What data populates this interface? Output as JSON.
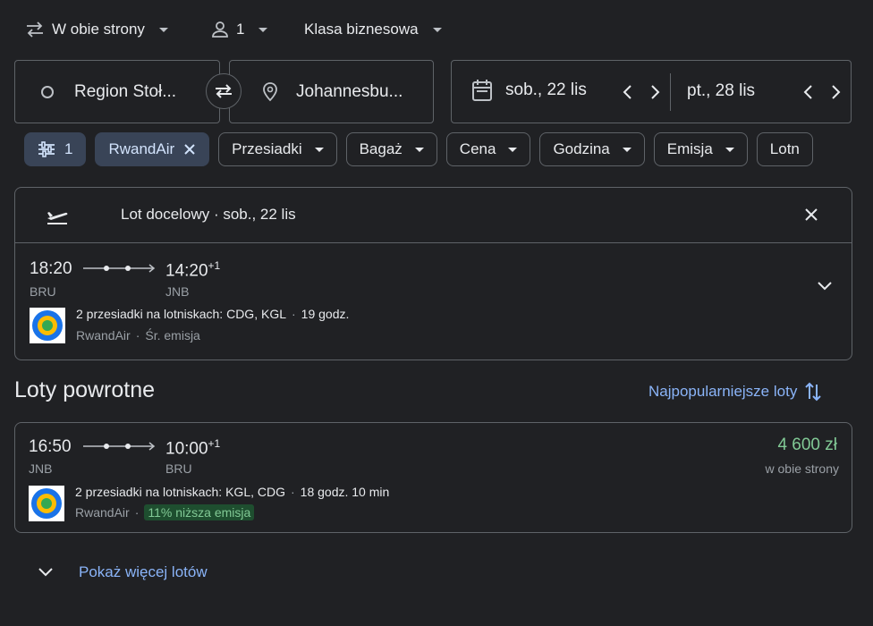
{
  "top_bar": {
    "trip_type": "W obie strony",
    "passengers": "1",
    "cabin_class": "Klasa biznesowa"
  },
  "search": {
    "origin": "Region Stoł...",
    "destination": "Johannesbu...",
    "depart_date": "sob., 22 lis",
    "return_date": "pt., 28 lis"
  },
  "filters": {
    "all_filters_count": "1",
    "active_chip": "RwandAir",
    "chips": [
      "Przesiadki",
      "Bagaż",
      "Cena",
      "Godzina",
      "Emisja",
      "Lotn"
    ]
  },
  "selected_flight": {
    "header": "Lot docelowy · sob., 22 lis",
    "depart_time": "18:20",
    "depart_code": "BRU",
    "arrive_time": "14:20",
    "arrive_offset": "+1",
    "arrive_code": "JNB",
    "stops_text": "2 przesiadki na lotniskach: CDG, KGL",
    "sep": "·",
    "duration": "19 godz.",
    "airline": "RwandAir",
    "emission": "Śr. emisja"
  },
  "return_section": {
    "title": "Loty powrotne",
    "sort_label": "Najpopularniejsze loty"
  },
  "return_flight": {
    "depart_time": "16:50",
    "depart_code": "JNB",
    "arrive_time": "10:00",
    "arrive_offset": "+1",
    "arrive_code": "BRU",
    "stops_text": "2 przesiadki na lotniskach: KGL, CDG",
    "sep": "·",
    "duration": "18 godz. 10 min",
    "airline": "RwandAir",
    "emission": "11% niższa emisja",
    "price": "4 600 zł",
    "price_note": "w obie strony"
  },
  "show_more": "Pokaż więcej lotów",
  "colors": {
    "background": "#202124",
    "border": "#5f6368",
    "accent_blue": "#8ab4f8",
    "price_green": "#81c995",
    "chip_active_bg": "#394457"
  }
}
